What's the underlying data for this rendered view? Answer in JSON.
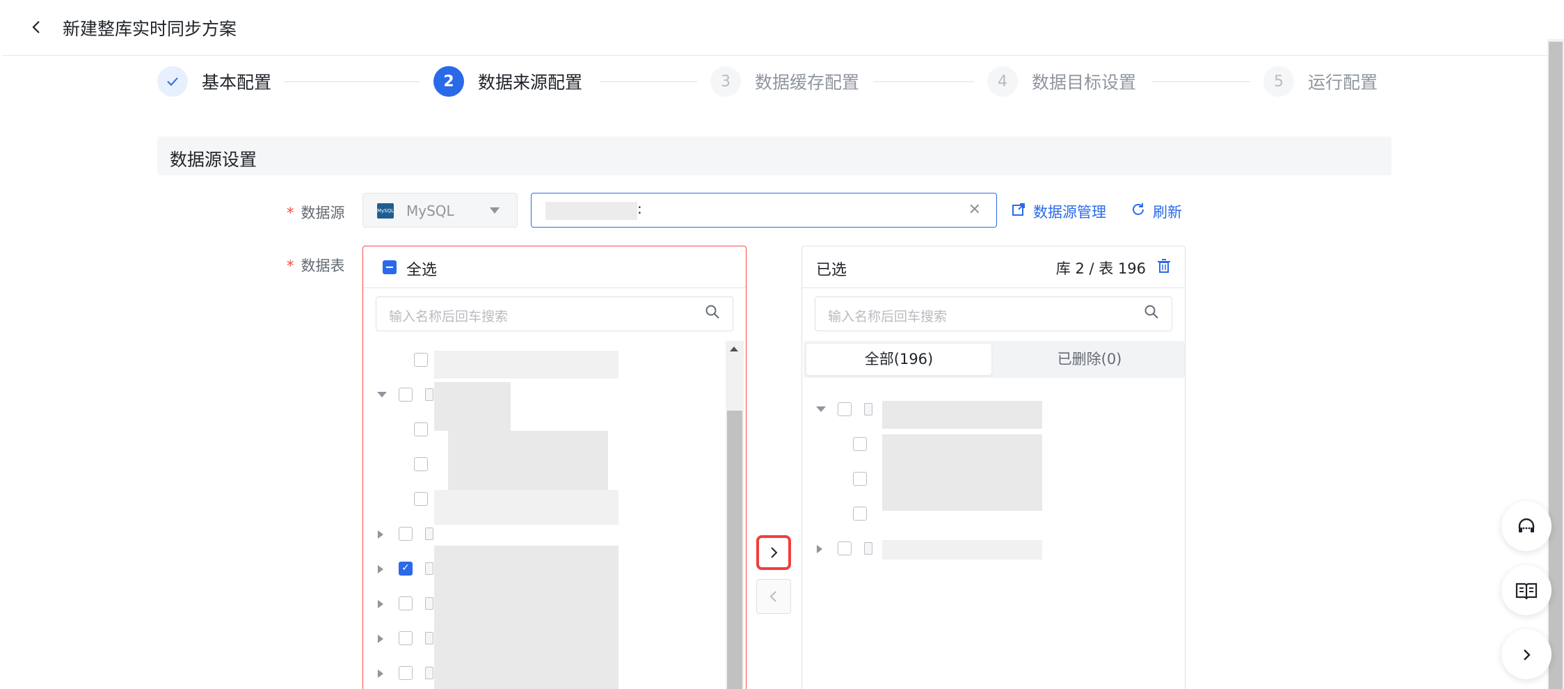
{
  "header": {
    "back_icon": "chevron-left-icon",
    "title": "新建整库实时同步方案"
  },
  "steps": [
    {
      "index": "1",
      "label": "基本配置",
      "status": "done"
    },
    {
      "index": "2",
      "label": "数据来源配置",
      "status": "active"
    },
    {
      "index": "3",
      "label": "数据缓存配置",
      "status": "wait"
    },
    {
      "index": "4",
      "label": "数据目标设置",
      "status": "wait"
    },
    {
      "index": "5",
      "label": "运行配置",
      "status": "wait"
    }
  ],
  "section": {
    "title": "数据源设置"
  },
  "form": {
    "datasource_label": "数据源",
    "table_label": "数据表",
    "required_mark": "*",
    "datasource_type": "MySQL",
    "datasource_logo_text": "MySQL",
    "connection_value": ":",
    "manage_link": "数据源管理",
    "refresh_link": "刷新"
  },
  "left_panel": {
    "select_all": "全选",
    "select_all_state": "indeterminate",
    "search_placeholder": "输入名称后回车搜索"
  },
  "right_panel": {
    "title": "已选",
    "summary": "库 2 / 表 196",
    "search_placeholder": "输入名称后回车搜索",
    "tabs": [
      {
        "label": "全部(196)",
        "active": true
      },
      {
        "label": "已删除(0)",
        "active": false
      }
    ]
  },
  "transfer": {
    "move_right_icon": "chevron-right-icon",
    "move_left_icon": "chevron-left-icon"
  },
  "floating": {
    "support_icon": "headset-icon",
    "docs_icon": "book-icon",
    "expand_icon": "chevron-right-icon"
  },
  "colors": {
    "primary": "#2a6ae9",
    "error": "#f54a45",
    "highlight": "#f03e3e"
  }
}
